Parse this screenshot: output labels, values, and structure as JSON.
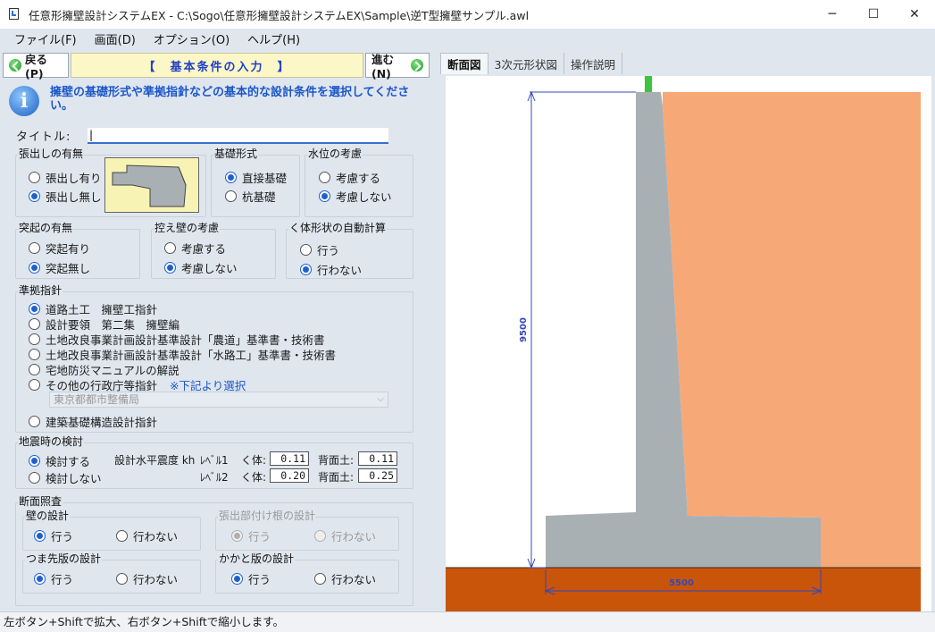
{
  "window": {
    "title": "任意形擁壁設計システムEX - C:\\Sogo\\任意形擁壁設計システムEX\\Sample\\逆T型擁壁サンプル.awl",
    "minimize": "─",
    "maximize": "☐",
    "close": "✕"
  },
  "menu": [
    "ファイル(F)",
    "画面(D)",
    "オプション(O)",
    "ヘルプ(H)"
  ],
  "nav": {
    "back": "戻る(P)",
    "title": "【　基本条件の入力　】",
    "next": "進む(N)"
  },
  "info_text": "擁壁の基礎形式や準拠指針などの基本的な設計条件を選択してください。",
  "title_field": {
    "label": "タイトル:",
    "value": "|"
  },
  "overhang": {
    "label": "張出しの有無",
    "options": [
      {
        "label": "張出し有り",
        "selected": false
      },
      {
        "label": "張出し無し",
        "selected": true
      }
    ]
  },
  "foundation": {
    "label": "基礎形式",
    "options": [
      {
        "label": "直接基礎",
        "selected": true
      },
      {
        "label": "杭基礎",
        "selected": false
      }
    ]
  },
  "water": {
    "label": "水位の考慮",
    "options": [
      {
        "label": "考慮する",
        "selected": false
      },
      {
        "label": "考慮しない",
        "selected": true
      }
    ]
  },
  "protrusion": {
    "label": "突起の有無",
    "options": [
      {
        "label": "突起有り",
        "selected": false
      },
      {
        "label": "突起無し",
        "selected": true
      }
    ]
  },
  "buttress": {
    "label": "控え壁の考慮",
    "options": [
      {
        "label": "考慮する",
        "selected": false
      },
      {
        "label": "考慮しない",
        "selected": true
      }
    ]
  },
  "auto_calc": {
    "label": "く体形状の自動計算",
    "options": [
      {
        "label": "行う",
        "selected": false
      },
      {
        "label": "行わない",
        "selected": true
      }
    ]
  },
  "standard": {
    "label": "準拠指針",
    "options": [
      {
        "label": "道路土工　擁壁工指針",
        "selected": true
      },
      {
        "label": "設計要領　第二集　擁壁編",
        "selected": false
      },
      {
        "label": "土地改良事業計画設計基準設計「農道」基準書・技術書",
        "selected": false
      },
      {
        "label": "土地改良事業計画設計基準設計「水路工」基準書・技術書",
        "selected": false
      },
      {
        "label": "宅地防災マニュアルの解説",
        "selected": false
      },
      {
        "label": "その他の行政庁等指針",
        "selected": false
      },
      {
        "label": "建築基礎構造設計指針",
        "selected": false
      }
    ],
    "note": "※下記より選択",
    "agency": "東京都都市整備局"
  },
  "seismic": {
    "label": "地震時の検討",
    "options": [
      {
        "label": "検討する",
        "selected": true
      },
      {
        "label": "検討しない",
        "selected": false
      }
    ],
    "kh_label": "設計水平震度 kh",
    "level1": "ﾚﾍﾞﾙ1",
    "level2": "ﾚﾍﾞﾙ2",
    "body_label": "く体:",
    "back_label": "背面土:",
    "l1_body": "0.11",
    "l1_back": "0.11",
    "l2_body": "0.20",
    "l2_back": "0.25"
  },
  "section_check": {
    "label": "断面照査",
    "wall": {
      "label": "壁の設計",
      "options": [
        {
          "label": "行う",
          "selected": true
        },
        {
          "label": "行わない",
          "selected": false
        }
      ]
    },
    "overhang_root": {
      "label": "張出部付け根の設計",
      "options": [
        {
          "label": "行う",
          "selected": true
        },
        {
          "label": "行わない",
          "selected": false
        }
      ]
    },
    "toe": {
      "label": "つま先版の設計",
      "options": [
        {
          "label": "行う",
          "selected": true
        },
        {
          "label": "行わない",
          "selected": false
        }
      ]
    },
    "heel": {
      "label": "かかと版の設計",
      "options": [
        {
          "label": "行う",
          "selected": true
        },
        {
          "label": "行わない",
          "selected": false
        }
      ]
    }
  },
  "tabs": [
    "断面図",
    "3次元形状図",
    "操作説明"
  ],
  "drawing": {
    "height_dim": "9500",
    "width_dim": "5500"
  },
  "colors": {
    "soil": "#f7a877",
    "ground": "#c9550b",
    "concrete": "#a9b0b4",
    "dimension": "#3548b8"
  },
  "status": "左ボタン+Shiftで拡大、右ボタン+Shiftで縮小します。"
}
